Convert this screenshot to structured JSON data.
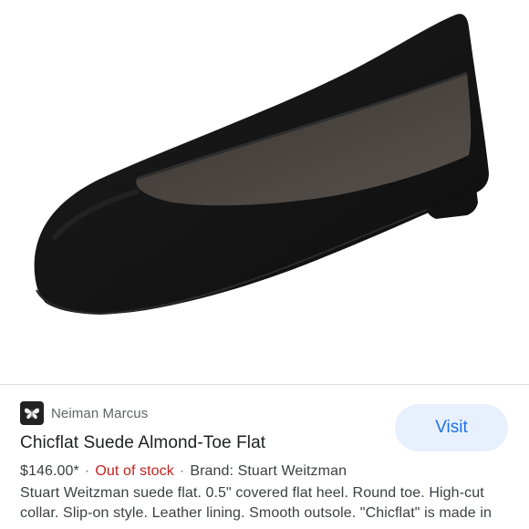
{
  "product": {
    "image_alt": "Black suede almond-toe ballet flat",
    "source_name": "Neiman Marcus",
    "source_logo_icon": "butterfly-icon",
    "title": "Chicflat Suede Almond-Toe Flat",
    "price": "$146.00*",
    "separator": "·",
    "stock_status": "Out of stock",
    "brand": "Brand: Stuart Weitzman",
    "description": "Stuart Weitzman suede flat. 0.5\" covered flat heel. Round toe. High-cut collar. Slip-on style. Leather lining. Smooth outsole. \"Chicflat\" is made in",
    "visit_label": "Visit"
  },
  "colors": {
    "accent": "#1a73e8",
    "visit_bg": "#e8f0fe",
    "stock_red": "#c5221f"
  }
}
